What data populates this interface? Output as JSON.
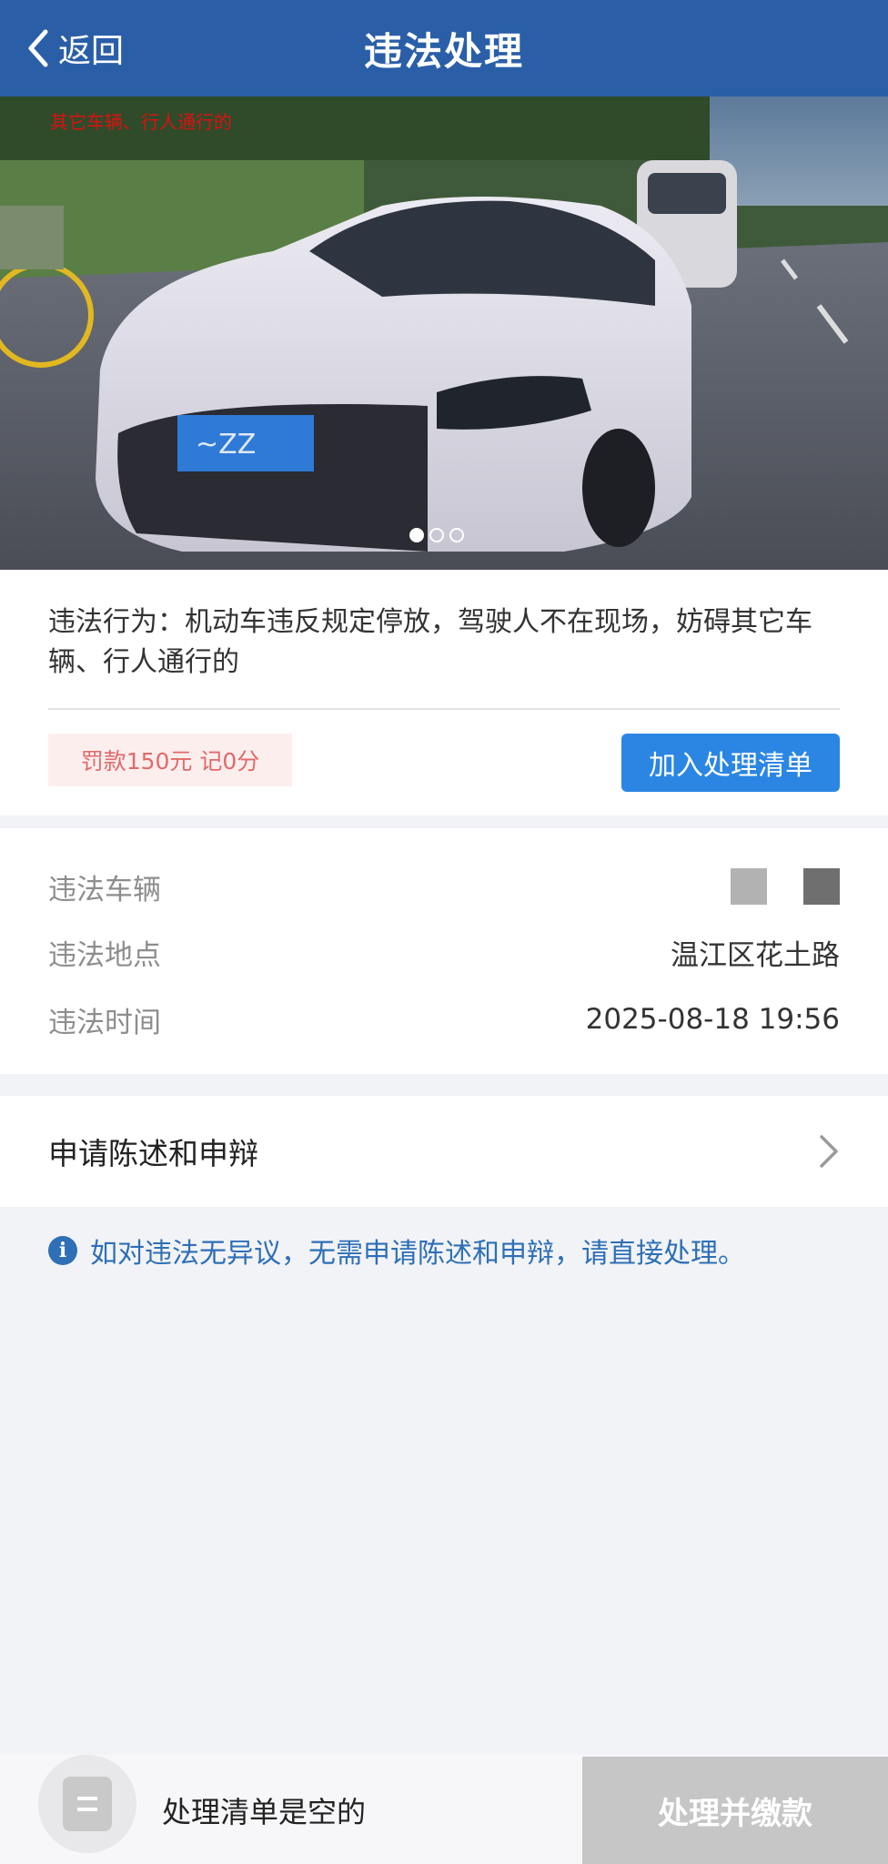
{
  "header": {
    "back_label": "返回",
    "title": "违法处理"
  },
  "photo": {
    "stamp_text": "其它车辆、行人通行的",
    "slides": 3,
    "active_slide": 1
  },
  "violation": {
    "behavior": "违法行为：机动车违反规定停放，驾驶人不在现场，妨碍其它车辆、行人通行的",
    "fine_badge": "罚款150元 记0分",
    "add_button": "加入处理清单"
  },
  "details": {
    "vehicle_label": "违法车辆",
    "location_label": "违法地点",
    "location_value": "温江区花土路",
    "time_label": "违法时间",
    "time_value": "2025-08-18 19:56"
  },
  "appeal": {
    "label": "申请陈述和申辩"
  },
  "notice": {
    "text": "如对违法无异议，无需申请陈述和申辩，请直接处理。"
  },
  "bottom": {
    "empty_text": "处理清单是空的",
    "pay_button": "处理并缴款"
  },
  "colors": {
    "header": "#2a5fa8",
    "primary_button": "#2b86e3",
    "fine_text": "#e06a6a",
    "notice_text": "#2e6fb5",
    "disabled_button": "#c6c6c6"
  }
}
